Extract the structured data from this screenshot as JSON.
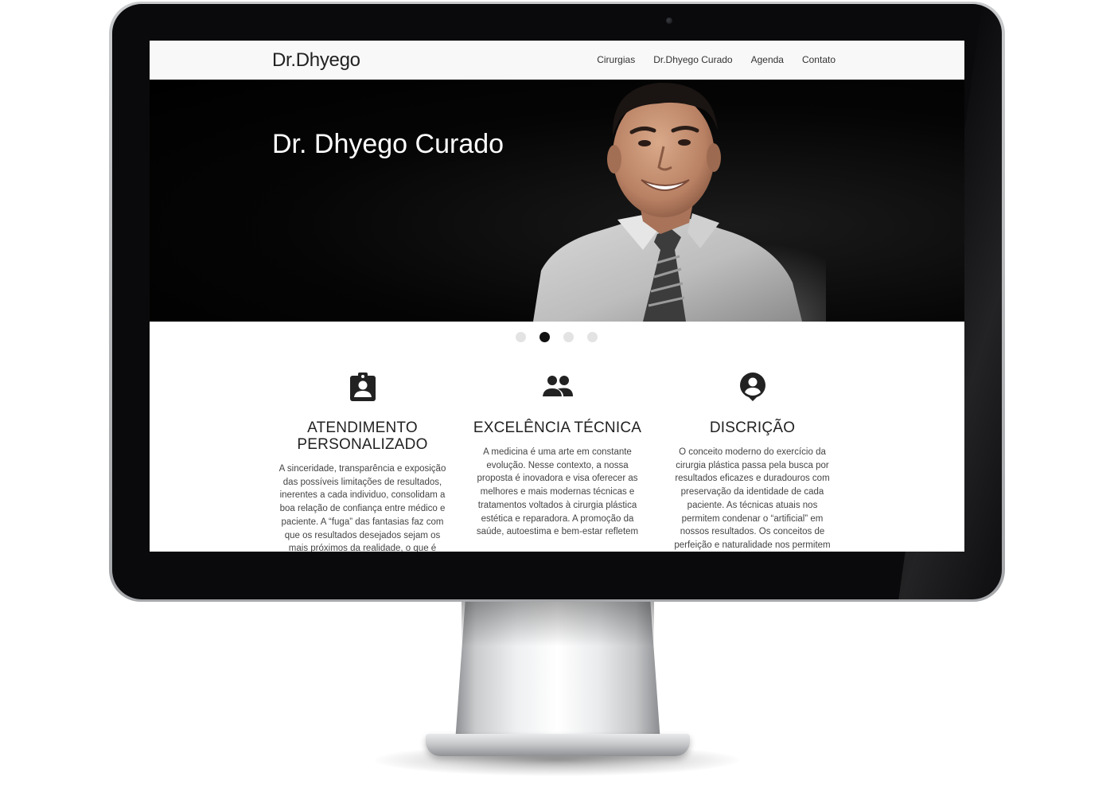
{
  "site": {
    "brand": "Dr.Dhyego",
    "nav": [
      {
        "label": "Cirurgias"
      },
      {
        "label": "Dr.Dhyego Curado"
      },
      {
        "label": "Agenda"
      },
      {
        "label": "Contato"
      }
    ]
  },
  "hero": {
    "title": "Dr. Dhyego Curado",
    "slides_total": 4,
    "active_slide": 2
  },
  "features": [
    {
      "icon": "clipboard-account-icon",
      "title": "ATENDIMENTO PERSONALIZADO",
      "text": "A sinceridade, transparência e exposição das possíveis limitações de resultados, inerentes a cada individuo, consolidam a boa relação de confiança entre médico e paciente. A “fuga” das fantasias faz com que os resultados desejados sejam os mais próximos da realidade, o que é"
    },
    {
      "icon": "people-icon",
      "title": "EXCELÊNCIA TÉCNICA",
      "text": "A medicina é uma arte em constante evolução. Nesse contexto, a nossa proposta é inovadora e visa oferecer as melhores e mais modernas técnicas e tratamentos voltados à cirurgia plástica estética e reparadora. A promoção da saúde, autoestima e bem-estar refletem"
    },
    {
      "icon": "account-pin-icon",
      "title": "DISCRIÇÃO",
      "text": "O conceito moderno do exercício da cirurgia plástica passa pela busca por resultados eficazes e duradouros com preservação da identidade de cada paciente. As técnicas atuais nos permitem condenar o “artificial” em nossos resultados. Os conceitos de perfeição e naturalidade nos permitem"
    }
  ],
  "colors": {
    "navbar_bg": "#f8f8f8",
    "hero_bg": "#000000",
    "dot_active": "#111111",
    "dot_inactive": "#e3e3e3"
  }
}
